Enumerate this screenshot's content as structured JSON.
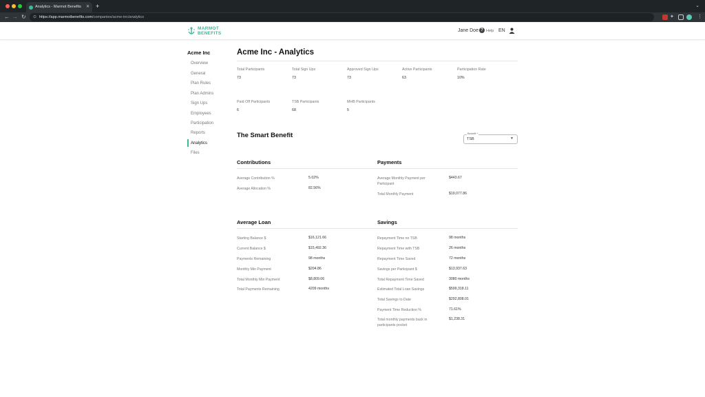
{
  "browser": {
    "tab_title": "Analytics - Marmot Benefits",
    "url_host": "https://app.marmotbenefits.com",
    "url_path": "/companies/acme-inc/analytics",
    "colors": {
      "chrome_dark": "#1f2427",
      "toolbar": "#2e3437",
      "close": "#ff5f57",
      "minimize": "#febc2e",
      "maximize": "#28c840"
    }
  },
  "header": {
    "logo_line1": "MARMOT",
    "logo_line2": "BENEFITS",
    "user_name": "Jane Doe",
    "help_label": "Help",
    "language": "EN",
    "brand_color": "#3fb79a"
  },
  "sidebar": {
    "company": "Acme Inc",
    "items": [
      {
        "label": "Overview"
      },
      {
        "label": "General"
      },
      {
        "label": "Plan Rules"
      },
      {
        "label": "Plan Admins"
      },
      {
        "label": "Sign Ups"
      },
      {
        "label": "Employees"
      },
      {
        "label": "Participation"
      },
      {
        "label": "Reports"
      },
      {
        "label": "Analytics",
        "active": true
      },
      {
        "label": "Files"
      }
    ]
  },
  "main": {
    "title": "Acme Inc - Analytics",
    "stats": [
      {
        "label": "Total Participants",
        "value": "73"
      },
      {
        "label": "Total Sign Ups",
        "value": "73"
      },
      {
        "label": "Approved Sign Ups",
        "value": "73"
      },
      {
        "label": "Active Participants",
        "value": "63"
      },
      {
        "label": "Participation Rate",
        "value": "10%"
      },
      {
        "label": "Paid Off Participants",
        "value": "6"
      },
      {
        "label": "TSB Participants",
        "value": "68"
      },
      {
        "label": "MHB Participants",
        "value": "5"
      }
    ],
    "section_title": "The Smart Benefit",
    "benefit_select": {
      "label": "Benefit *",
      "value": "TSB"
    },
    "contributions": {
      "title": "Contributions",
      "rows": [
        {
          "k": "Average Contribution %",
          "v": "5.02%"
        },
        {
          "k": "Average Allocation %",
          "v": "82.56%"
        }
      ]
    },
    "payments": {
      "title": "Payments",
      "rows": [
        {
          "k": "Average Monthly Payment per Participant",
          "v": "$443.67"
        },
        {
          "k": "Total Monthly Payment",
          "v": "$19,077.86"
        }
      ]
    },
    "average_loan": {
      "title": "Average Loan",
      "rows": [
        {
          "k": "Starting Balance $",
          "v": "$16,121.66"
        },
        {
          "k": "Current Balance $",
          "v": "$15,492.36"
        },
        {
          "k": "Payments Remaining",
          "v": "98 months"
        },
        {
          "k": "Monthly Min Payment",
          "v": "$204.86"
        },
        {
          "k": "Total Monthly Min Payment",
          "v": "$8,809.06"
        },
        {
          "k": "Total Payments Remaining",
          "v": "4209 months"
        }
      ]
    },
    "savings": {
      "title": "Savings",
      "rows": [
        {
          "k": "Repayment Time no TSB",
          "v": "98 months"
        },
        {
          "k": "Repayment Time with TSB",
          "v": "26 months"
        },
        {
          "k": "Repayment Time Saved",
          "v": "72 months"
        },
        {
          "k": "Savings per Participant $",
          "v": "$13,937.63"
        },
        {
          "k": "Total Repayment Time Saved",
          "v": "3080 months"
        },
        {
          "k": "Estimated Total Loan Savings",
          "v": "$599,318.11"
        },
        {
          "k": "Total Savings to Date",
          "v": "$292,808.01"
        },
        {
          "k": "Payment Time Reduction %",
          "v": "71.61%"
        },
        {
          "k": "Total monthly payments back in participants pocket",
          "v": "$1,238.31"
        }
      ]
    }
  }
}
